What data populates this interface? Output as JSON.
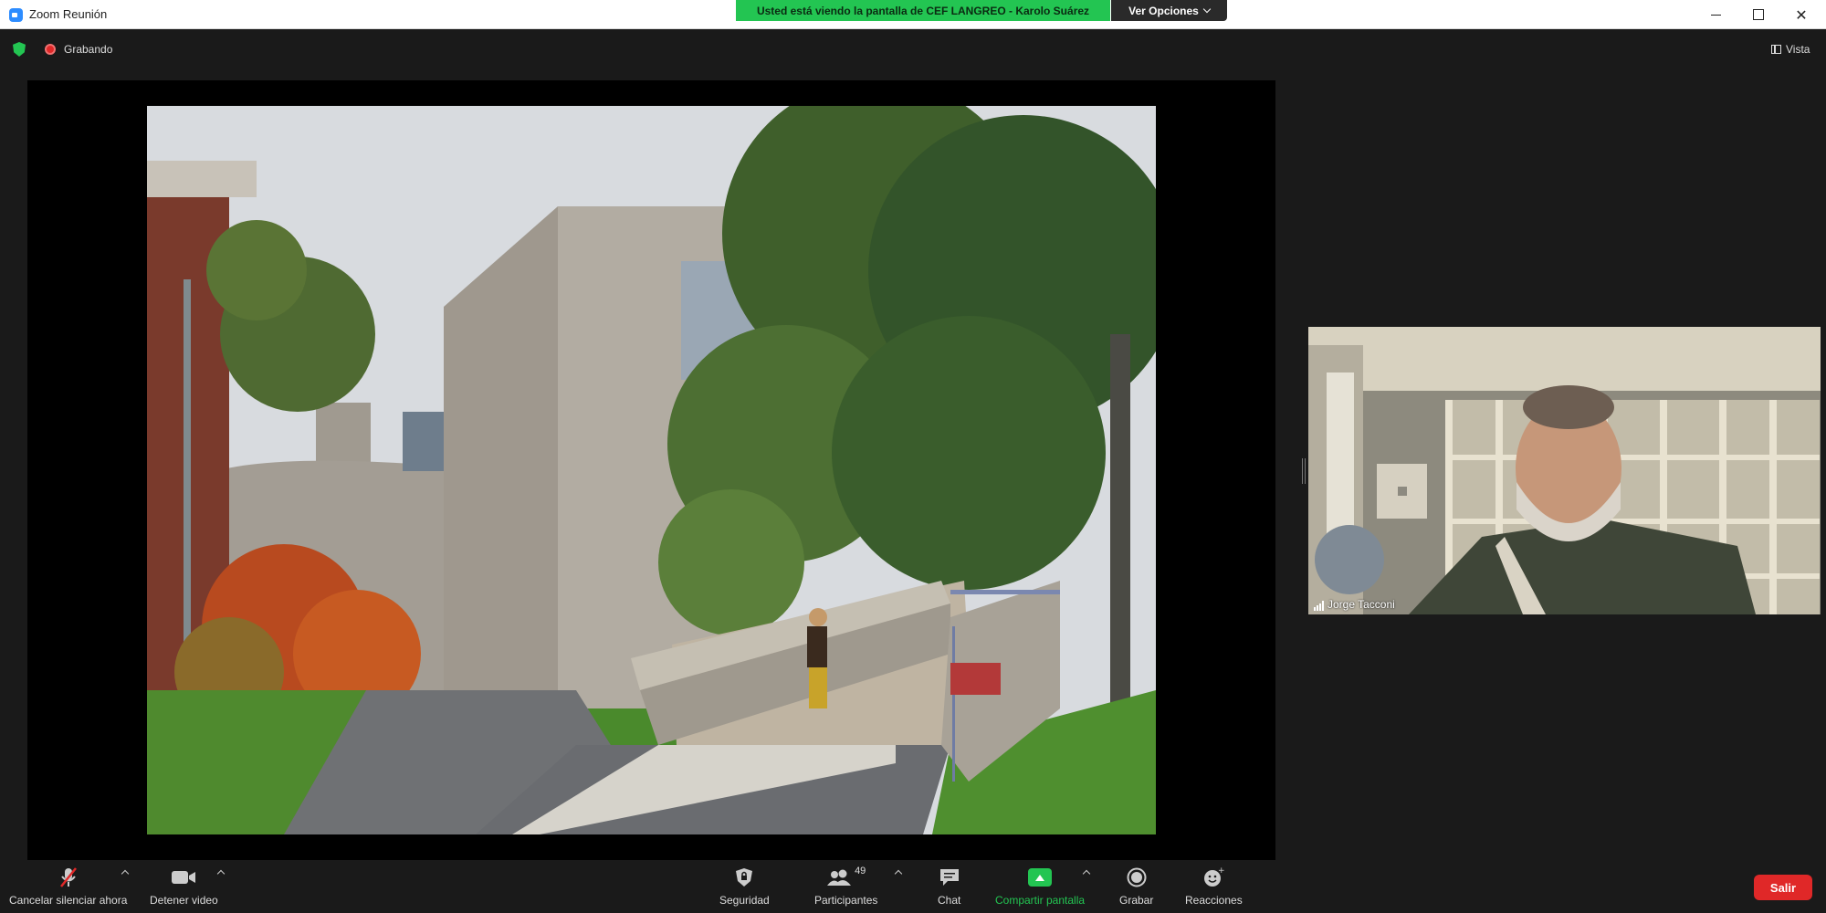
{
  "window": {
    "title": "Zoom Reunión",
    "close_glyph": "✕"
  },
  "share_banner": {
    "text": "Usted está viendo la pantalla de CEF LANGREO - Karolo Suárez",
    "options_label": "Ver Opciones"
  },
  "status": {
    "recording_label": "Grabando",
    "view_label": "Vista"
  },
  "participant": {
    "name": "Jorge Tacconi"
  },
  "toolbar": {
    "mute_label": "Cancelar silenciar ahora",
    "video_label": "Detener video",
    "security_label": "Seguridad",
    "participants_label": "Participantes",
    "participants_count": "49",
    "chat_label": "Chat",
    "share_label": "Compartir pantalla",
    "record_label": "Grabar",
    "reactions_label": "Reacciones",
    "leave_label": "Salir"
  },
  "colors": {
    "banner_green": "#23c552",
    "leave_red": "#e02828",
    "background": "#1a1a1a"
  },
  "icons": [
    "zoom-app-icon",
    "shield-icon",
    "recording-icon",
    "view-icon",
    "microphone-muted-icon",
    "video-camera-icon",
    "security-shield-icon",
    "participants-icon",
    "chat-bubble-icon",
    "share-screen-icon",
    "record-icon",
    "reactions-icon",
    "signal-icon"
  ]
}
